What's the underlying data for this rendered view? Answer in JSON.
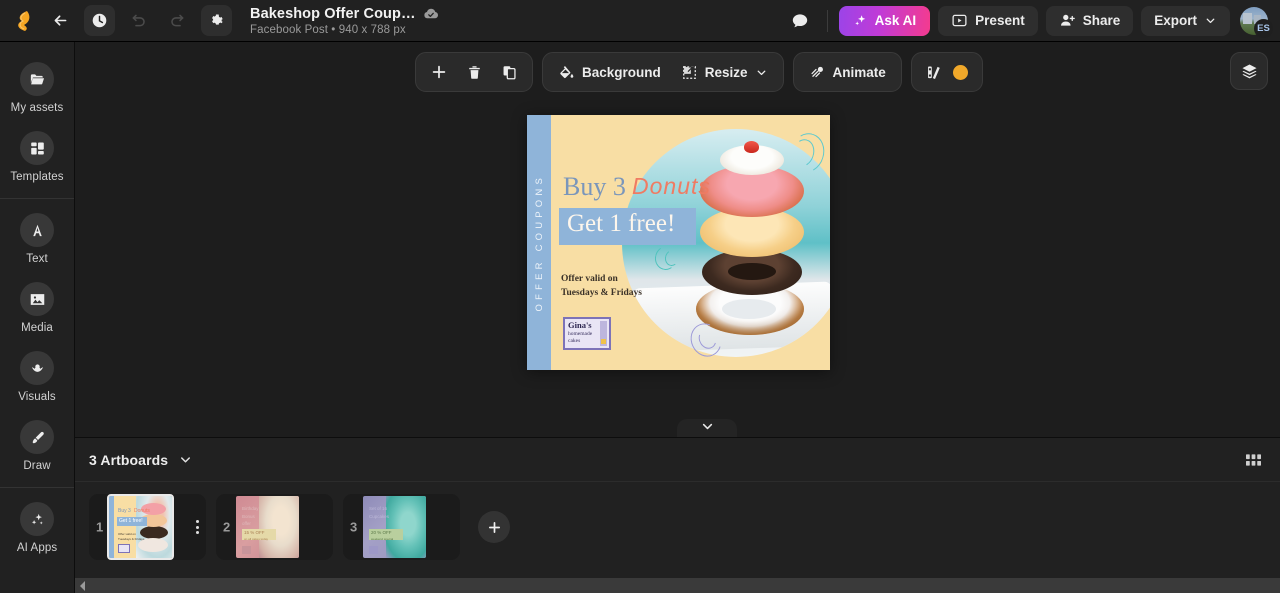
{
  "app": {
    "logo_name": "app-logo"
  },
  "topbar": {
    "back_label": "back-icon",
    "history_label": "history-icon",
    "undo_label": "undo-icon",
    "redo_label": "redo-icon",
    "settings_label": "settings-icon",
    "doc_title": "Bakeshop Offer Coup…",
    "doc_subtitle": "Facebook Post • 940 x 788 px",
    "saved_icon": "cloud-check-icon",
    "comment_icon": "comment-icon",
    "ask_ai_label": "Ask AI",
    "present_label": "Present",
    "share_label": "Share",
    "export_label": "Export",
    "avatar_initials": "ES"
  },
  "sidebar": {
    "items": [
      {
        "label": "My assets",
        "icon": "folder-icon"
      },
      {
        "label": "Templates",
        "icon": "templates-grid-icon"
      },
      {
        "label": "Text",
        "icon": "text-a-icon"
      },
      {
        "label": "Media",
        "icon": "image-icon"
      },
      {
        "label": "Visuals",
        "icon": "lotus-icon"
      },
      {
        "label": "Draw",
        "icon": "brush-icon"
      },
      {
        "label": "AI Apps",
        "icon": "sparkles-icon"
      }
    ]
  },
  "toolbar": {
    "add_label": "plus-icon",
    "delete_label": "trash-icon",
    "duplicate_label": "duplicate-icon",
    "background_label": "Background",
    "resize_label": "Resize",
    "animate_label": "Animate",
    "palette_label": "color-palette-icon",
    "palette_color": "#f0a82a",
    "layers_label": "layers-icon"
  },
  "design": {
    "side_strip_text": "OFFER COUPONS",
    "headline_part1": "Buy 3",
    "headline_part2": "Donuts",
    "subhead": "Get 1 free!",
    "fine_print_line1": "Offer valid on",
    "fine_print_line2": "Tuesdays & Fridays",
    "brand_name": "Gina's",
    "brand_tagline_line1": "homemade",
    "brand_tagline_line2": "cakes",
    "bg_color": "#f8dea4",
    "accent_blue": "#8fb4d9",
    "accent_coral": "#ef7b63"
  },
  "canvas": {
    "collapse_icon": "chevron-down-icon"
  },
  "artboards_panel": {
    "title": "3 Artboards",
    "chevron_icon": "chevron-down-icon",
    "grid_view_icon": "grid-view-icon",
    "add_artboard_icon": "plus-icon",
    "items": [
      {
        "number": "1",
        "selected": true,
        "menu_icon": "more-vertical-icon",
        "thumb": {
          "headline1": "Buy 3",
          "headline2": "Donuts",
          "subhead": "Get 1 free!",
          "fine1": "Offer valid on",
          "fine2": "Tuesdays & Fridays"
        }
      },
      {
        "number": "2",
        "selected": false,
        "menu_icon": "more-vertical-icon",
        "thumb": {
          "line1": "Birthday",
          "line2": "Bonus",
          "line3": "offer",
          "offer": "15 % OFF",
          "offer_sub": "on all cakes today"
        }
      },
      {
        "number": "3",
        "selected": false,
        "menu_icon": "more-vertical-icon",
        "thumb": {
          "line1": "Set of 16",
          "line2": "Cupcakes",
          "offer": "20 % OFF",
          "offer_sub": "weekend special"
        }
      }
    ]
  },
  "scrollbar": {
    "left_arrow_icon": "scroll-left-arrow-icon"
  }
}
